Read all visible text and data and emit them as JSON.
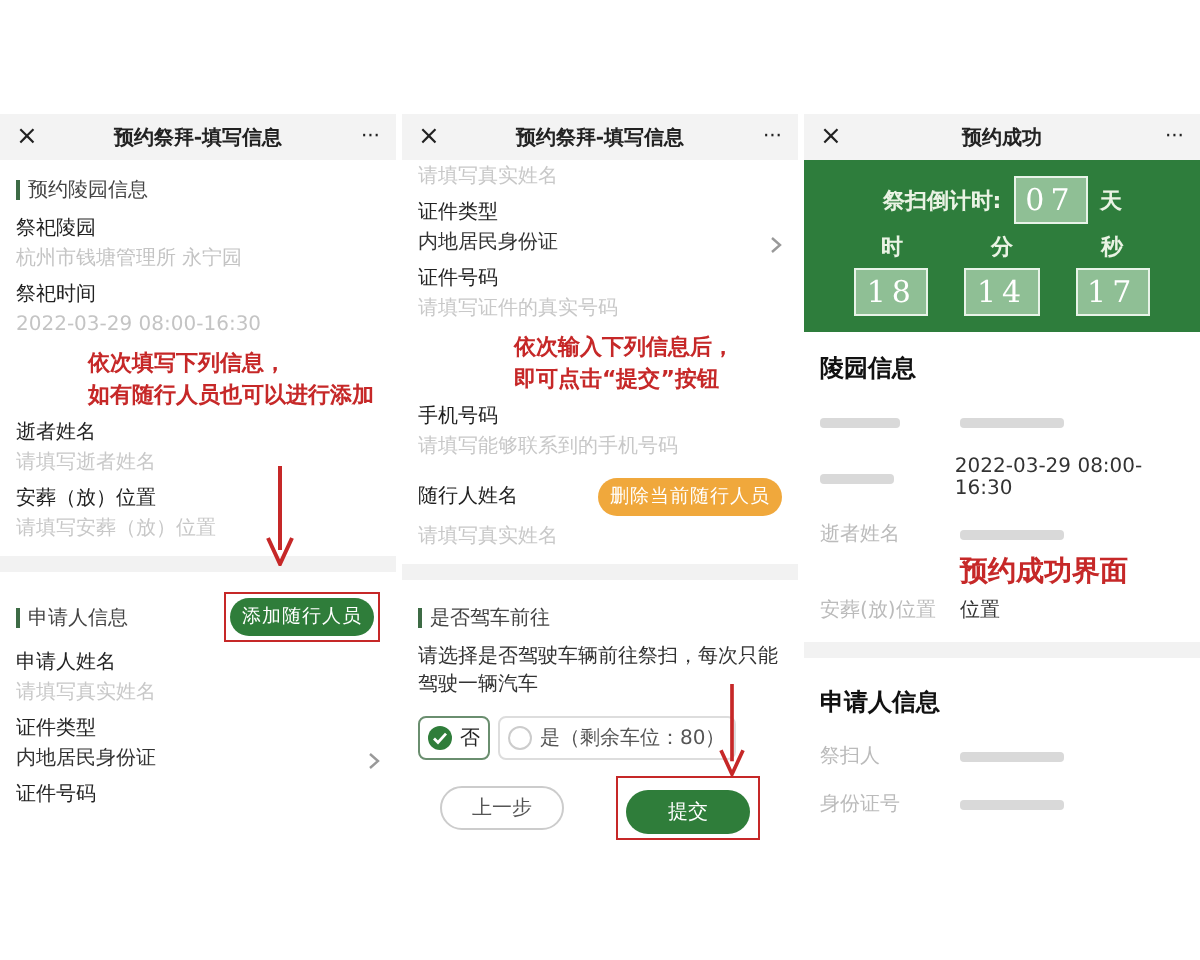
{
  "screens": [
    {
      "header": {
        "close": "×",
        "title": "预约祭拜-填写信息",
        "more": "···"
      },
      "items": [
        {
          "kind": "section",
          "title": "预约陵园信息"
        },
        {
          "kind": "field",
          "label": "祭祀陵园",
          "value": "杭州市钱塘管理所 永宁园",
          "disabled": true
        },
        {
          "kind": "field",
          "label": "祭祀时间",
          "value": "2022-03-29 08:00-16:30",
          "disabled": true
        },
        {
          "kind": "annotation",
          "lines": [
            "依次填写下列信息，",
            "如有随行人员也可以进行添加"
          ]
        },
        {
          "kind": "field",
          "label": "逝者姓名",
          "placeholder": "请填写逝者姓名"
        },
        {
          "kind": "field",
          "label": "安葬（放）位置",
          "placeholder": "请填写安葬（放）位置"
        },
        {
          "kind": "gap"
        },
        {
          "kind": "section",
          "title": "申请人信息",
          "action": {
            "text": "添加随行人员",
            "kind": "primary",
            "highlighted": true,
            "arrow": true
          }
        },
        {
          "kind": "field",
          "label": "申请人姓名",
          "placeholder": "请填写真实姓名"
        },
        {
          "kind": "field",
          "label": "证件类型",
          "value": "内地居民身份证",
          "select": true
        },
        {
          "kind": "label",
          "label": "证件号码"
        }
      ]
    },
    {
      "header": {
        "close": "×",
        "title": "预约祭拜-填写信息",
        "more": "···"
      },
      "items": [
        {
          "kind": "hint",
          "placeholder": "请填写真实姓名"
        },
        {
          "kind": "field",
          "label": "证件类型",
          "value": "内地居民身份证",
          "select": true
        },
        {
          "kind": "field",
          "label": "证件号码",
          "placeholder": "请填写证件的真实号码"
        },
        {
          "kind": "annotation",
          "lines": [
            "依次输入下列信息后，",
            "即可点击“提交”按钮"
          ]
        },
        {
          "kind": "field",
          "label": "手机号码",
          "placeholder": "请填写能够联系到的手机号码"
        },
        {
          "kind": "section",
          "title": "随行人姓名",
          "plain": true,
          "action": {
            "text": "删除当前随行人员",
            "kind": "warning",
            "highlighted": false
          }
        },
        {
          "kind": "hint",
          "placeholder": "请填写真实姓名"
        },
        {
          "kind": "gap"
        },
        {
          "kind": "section",
          "title": "是否驾车前往"
        },
        {
          "kind": "note",
          "text": "请选择是否驾驶车辆前往祭扫，每次只能驾驶一辆汽车"
        },
        {
          "kind": "choices",
          "options": [
            {
              "label": "否",
              "selected": true
            },
            {
              "label": "是（剩余车位：80）",
              "selected": false
            }
          ]
        },
        {
          "kind": "buttons",
          "buttons": [
            {
              "text": "上一步",
              "kind": "secondary",
              "highlighted": false
            },
            {
              "text": "提交",
              "kind": "primary",
              "highlighted": true,
              "arrow": true
            }
          ]
        }
      ]
    },
    {
      "header": {
        "close": "×",
        "title": "预约成功",
        "more": "···"
      },
      "items": [
        {
          "kind": "countdown",
          "label": "祭扫倒计时:",
          "days": "07",
          "day_unit": "天",
          "units": [
            {
              "label": "时",
              "value": "18"
            },
            {
              "label": "分",
              "value": "14"
            },
            {
              "label": "秒",
              "value": "17"
            }
          ]
        },
        {
          "kind": "heading",
          "title": "陵园信息"
        },
        {
          "kind": "row",
          "label_blurred": true,
          "value_blurred": true
        },
        {
          "kind": "row",
          "label_blurred": true,
          "value": "2022-03-29 08:00-16:30"
        },
        {
          "kind": "row",
          "label": "逝者姓名",
          "value_blurred": true
        },
        {
          "kind": "annotation",
          "lines": [
            "预约成功界面"
          ]
        },
        {
          "kind": "row",
          "label": "安葬(放)位置",
          "value": "位置"
        },
        {
          "kind": "gap"
        },
        {
          "kind": "heading",
          "title": "申请人信息"
        },
        {
          "kind": "row",
          "label": "祭扫人",
          "value_blurred": true
        },
        {
          "kind": "row",
          "label": "身份证号",
          "value_blurred": true
        }
      ]
    }
  ]
}
